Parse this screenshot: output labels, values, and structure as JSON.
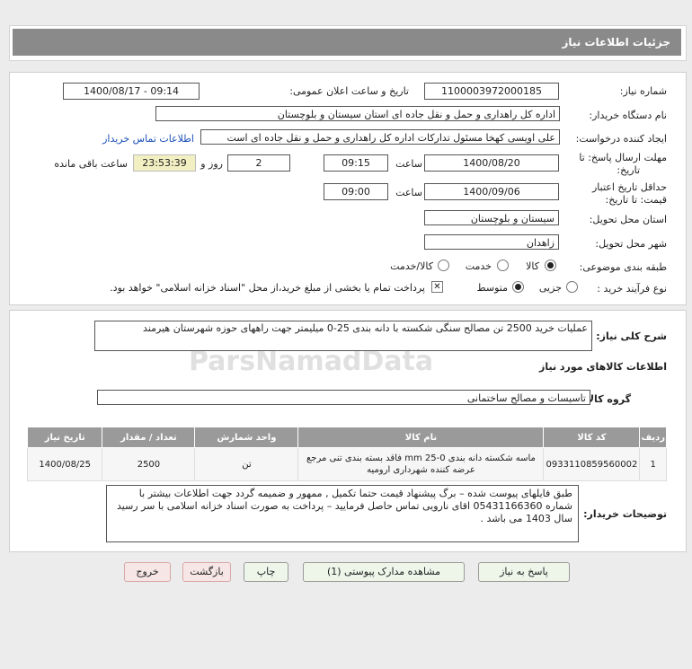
{
  "header": {
    "title": "جزئیات اطلاعات نیاز"
  },
  "form": {
    "need_number_label": "شماره نیاز:",
    "need_number": "1100003972000185",
    "announce_label": "تاریخ و ساعت اعلان عمومی:",
    "announce_value": "1400/08/17 - 09:14",
    "buyer_org_label": "نام دستگاه خریدار:",
    "buyer_org": "اداره کل راهداری و حمل و نقل جاده ای استان سیستان و بلوچستان",
    "creator_label": "ایجاد کننده درخواست:",
    "creator": "علی اویسی کهخا مسئول تدارکات اداره کل راهداری و حمل و نقل جاده ای است",
    "contact_link": "اطلاعات تماس خریدار",
    "deadline_label_1": "مهلت ارسال پاسخ: تا",
    "deadline_label_2": "تاریخ:",
    "deadline_date": "1400/08/20",
    "time_label": "ساعت",
    "deadline_time": "09:15",
    "days_value": "2",
    "days_label": "روز و",
    "remaining_time": "23:53:39",
    "remaining_label": "ساعت باقی مانده",
    "validity_label_1": "حداقل تاریخ اعتبار",
    "validity_label_2": "قیمت: تا تاریخ:",
    "validity_date": "1400/09/06",
    "validity_time": "09:00",
    "province_label": "استان محل تحویل:",
    "province": "سیستان و بلوچستان",
    "city_label": "شهر محل تحویل:",
    "city": "زاهدان",
    "category_label": "طبقه بندی موضوعی:",
    "category_options": [
      "کالا",
      "خدمت",
      "کالا/خدمت"
    ],
    "process_label": "نوع فرآیند خرید :",
    "process_options": [
      "جزیی",
      "متوسط"
    ],
    "payment_note": "پرداخت تمام یا بخشی از مبلغ خرید،از محل \"اسناد خزانه اسلامی\" خواهد بود."
  },
  "summary": {
    "label": "شرح کلی نیاز:",
    "text": "عملیات خرید 2500 تن مصالح سنگی شکسته با دانه بندی 25-0 میلیمتر جهت راههای حوزه شهرستان هیرمند"
  },
  "goods": {
    "section_title": "اطلاعات کالاهای مورد نیاز",
    "group_label": "گروه کالا:",
    "group_value": "تاسیسات و مصالح ساختمانی",
    "table_headers": [
      "ردیف",
      "کد کالا",
      "نام کالا",
      "واحد شمارش",
      "تعداد / مقدار",
      "تاریخ نیاز"
    ],
    "rows": [
      {
        "row": "1",
        "code": "0933110859560002",
        "name": "ماسه شکسته دانه بندی mm 25-0 فاقد بسته بندی تنی مرجع عرضه کننده شهرداری ارومیه",
        "unit": "تن",
        "qty": "2500",
        "date": "1400/08/25"
      }
    ]
  },
  "buyer_notes": {
    "label": "توضیحات خریدار:",
    "text": "طبق فایلهای پیوست شده – برگ پیشنهاد قیمت حتما تکمیل , ممهور و ضمیمه گردد جهت اطلاعات بیشتر با شماره 05431166360 اقای نارویی تماس حاصل فرمایید – پرداخت به صورت اسناد خزانه اسلامی با سر رسید سال 1403 می باشد ."
  },
  "buttons": {
    "reply": "پاسخ به نیاز",
    "view_docs": "مشاهده مدارک پیوستی (1)",
    "print": "چاپ",
    "back": "بازگشت",
    "exit": "خروج"
  },
  "colors": {
    "header_bg": "#8a8a8a",
    "link": "#1a4fb8",
    "table_header_bg": "#9a9a9a",
    "timer_bg": "#f2f0c2"
  }
}
